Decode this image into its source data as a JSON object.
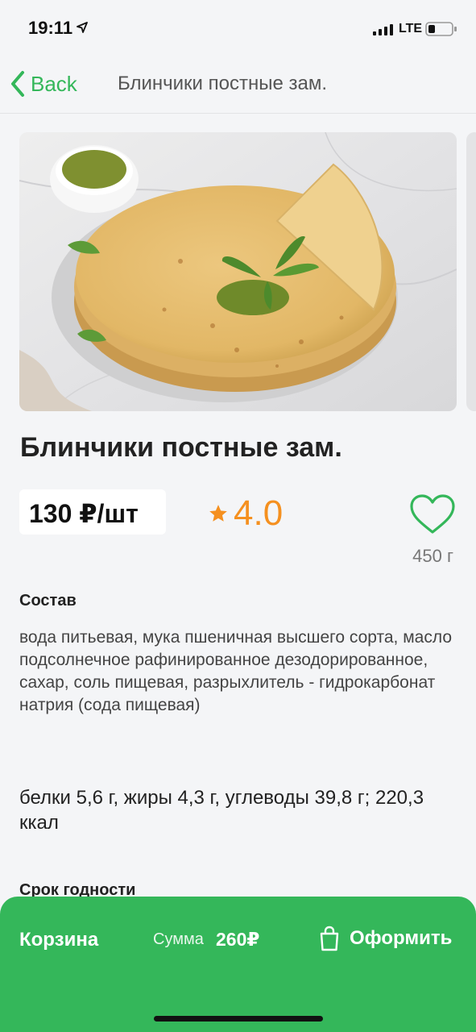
{
  "status_bar": {
    "time": "19:11",
    "network": "LTE",
    "icons": [
      "location-arrow-icon",
      "signal-icon",
      "battery-icon"
    ]
  },
  "nav": {
    "back_label": "Back",
    "title": "Блинчики постные зам."
  },
  "product": {
    "image_icon": "product-photo",
    "title": "Блинчики постные зам.",
    "price": "130 ₽/шт",
    "rating": "4.0",
    "weight": "450 г"
  },
  "composition": {
    "heading": "Состав",
    "text": "вода питьевая, мука пшеничная высшего сорта, масло подсолнечное рафинированное дезодорированное, сахар, соль пищевая, разрыхлитель - гидрокарбонат натрия (сода пищевая)"
  },
  "nutrition": {
    "text": "белки 5,6 г, жиры 4,3 г, углеводы 39,8 г; 220,3 ккал"
  },
  "shelf_life": {
    "heading": "Срок годности"
  },
  "cart": {
    "label": "Корзина",
    "sum_label": "Сумма",
    "sum_value": "260₽",
    "checkout_label": "Оформить"
  },
  "colors": {
    "accent": "#34b75a",
    "rating": "#f5901f",
    "background": "#f4f5f7"
  }
}
